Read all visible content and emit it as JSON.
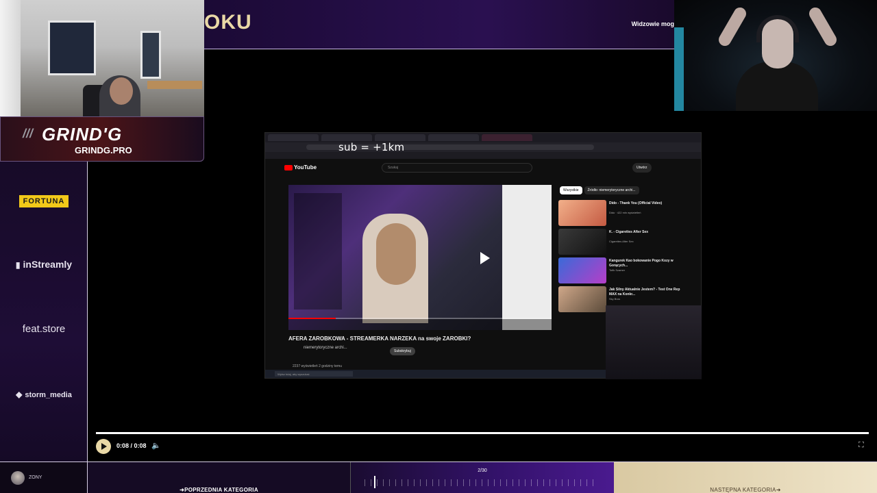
{
  "header": {
    "title": "OKU",
    "viewers": "Widzowie mog"
  },
  "logo": {
    "name": "GRIND'G",
    "site": "GRINDG.PRO"
  },
  "sponsors": {
    "fortuna": "FORTUNA",
    "instreamly": "inStreamly",
    "feat": "feat.store",
    "storm": "storm_media"
  },
  "embedded": {
    "overlay_text": "sub = +1km",
    "search_placeholder": "Szukaj",
    "create_label": "Utwórz",
    "video_title": "AFERA ZAROBKOWA - STREAMERKA NARZEKA na swoje ZAROBKI?",
    "channel": "niemerytoryczne archi...",
    "subscribe_label": "Subskrybuj",
    "views": "2237 wyświetleń 2 godziny temu",
    "chips": [
      "Wszystkie",
      "Źródło: niemerytoryczne archi..."
    ],
    "recommendations": [
      {
        "title": "Dido - Thank You (Official Video)",
        "meta": "Dido · 422 mln wyświetleń"
      },
      {
        "title": "K. - Cigarettes After Sex",
        "meta": "Cigarettes After Sex"
      },
      {
        "title": "Kangurek Kao bokowanie Pogo Kozy w Gorących...",
        "meta": "Tofik Szamer"
      },
      {
        "title": "Jak Silny Aktualnie Jestem? - Test One Rep MAX na Konkr...",
        "meta": "Sky Bros"
      }
    ],
    "taskbar_search": "Wpisz tutaj, aby wyszukać"
  },
  "player": {
    "time": "0:08 / 0:08"
  },
  "bottom": {
    "username": "ZONY",
    "prev_label": "POPRZEDNIA KATEGORIA",
    "progress_count": "2/30",
    "next_label": "NASTĘPNA KATEGORIA"
  },
  "colors": {
    "accent_gold": "#e9d8a6",
    "purple": "#33126a",
    "youtube_red": "#ff0000"
  }
}
